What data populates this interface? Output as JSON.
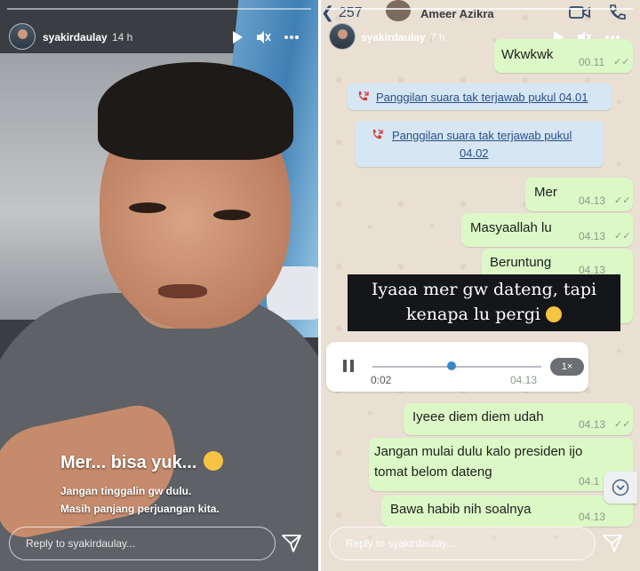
{
  "left_story": {
    "username": "syakirdaulay",
    "time_ago": "14 h",
    "caption_main": "Mer... bisa yuk...",
    "caption_line1": "Jangan tinggalin gw dulu.",
    "caption_line2": "Masih panjang perjuangan kita.",
    "reply_placeholder": "Reply to syakirdaulay...",
    "icons": [
      "play-icon",
      "mute-icon",
      "more-icon",
      "send-icon",
      "crying-emoji-icon"
    ]
  },
  "right_story": {
    "username": "syakirdaulay",
    "time_ago": "7 h",
    "reply_placeholder": "Reply to syakirdaulay...",
    "chat": {
      "back_count": "257",
      "contact_name": "Ameer Azikra",
      "messages": [
        {
          "text": "Wkwkwk",
          "time": "00.11"
        },
        {
          "text": "Mer",
          "time": "04.13"
        },
        {
          "text": "Masyaallah lu",
          "time": "04.13"
        },
        {
          "text": "Beruntung",
          "time": "04.13"
        },
        {
          "text": "Iyeee diem diem udah",
          "time": "04.13"
        },
        {
          "text_line1": "Jangan mulai dulu kalo presiden ijo",
          "text_line2": "tomat belom dateng",
          "time": "04.1"
        },
        {
          "text": "Bawa habib nih soalnya",
          "time": "04.13"
        }
      ],
      "missed_calls": [
        {
          "text": "Panggilan suara tak terjawab pukul 04.01"
        },
        {
          "text_line1": "Panggilan suara tak terjawab pukul",
          "text_line2": "04.02"
        }
      ],
      "voice_note": {
        "elapsed": "0:02",
        "time": "04.13",
        "speed": "1×",
        "progress": 0.45
      }
    },
    "overlay_line1": "Iyaaa mer gw dateng, tapi",
    "overlay_line2": "kenapa lu pergi",
    "icons": [
      "play-icon",
      "mute-icon",
      "more-icon",
      "send-icon",
      "video-call-icon",
      "phone-icon",
      "scroll-down-icon"
    ]
  },
  "colors": {
    "outgoing_bubble": "#dcf8c6",
    "system_bubble": "#d6e6f2",
    "link": "#2a4e8a"
  }
}
